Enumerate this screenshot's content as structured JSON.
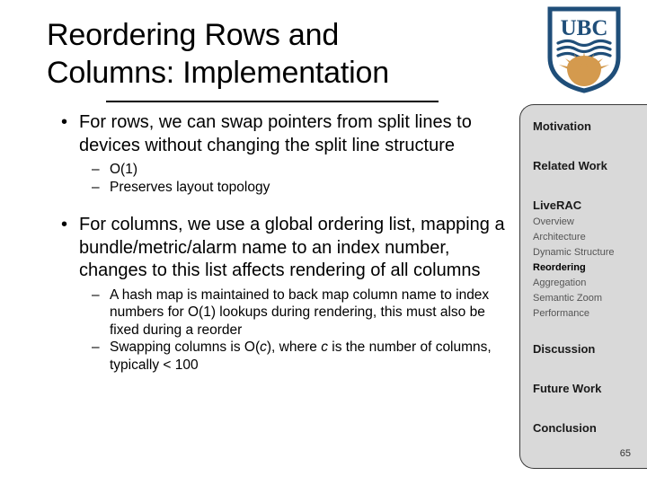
{
  "slide": {
    "title_lines": [
      "Reordering Rows and",
      "Columns: Implementation"
    ],
    "slide_number": "65",
    "logo": {
      "name": "ubc-crest",
      "wordmark": "UBC",
      "shield_color": "#1f4e79",
      "sun_color": "#d49a4e"
    }
  },
  "content": {
    "bullet_char": "•",
    "dash_char": "–",
    "bullets": [
      {
        "text": "For rows, we can swap pointers from split lines to devices without changing the split line structure",
        "sub": [
          {
            "text": "O(1)"
          },
          {
            "text": "Preserves layout topology"
          }
        ]
      },
      {
        "text": "For columns, we use a global ordering list, mapping a bundle/metric/alarm name to an index number, changes to this list affects rendering of all columns",
        "sub": [
          {
            "text": "A hash map is maintained to back map column name to index numbers for O(1) lookups during rendering, this must also be fixed during a reorder"
          },
          {
            "parts": [
              {
                "t": "Swapping columns is O(",
                "i": false
              },
              {
                "t": "c",
                "i": true
              },
              {
                "t": "), where ",
                "i": false
              },
              {
                "t": "c",
                "i": true
              },
              {
                "t": " is the number of columns, typically < 100",
                "i": false
              }
            ]
          }
        ]
      }
    ]
  },
  "nav": {
    "background": "#d9d9d9",
    "items": [
      {
        "label": "Motivation",
        "level": "major",
        "current": false
      },
      {
        "label": "Related Work",
        "level": "major",
        "current": false
      },
      {
        "label": "LiveRAC",
        "level": "major",
        "current": false
      },
      {
        "label": "Overview",
        "level": "sub",
        "current": false
      },
      {
        "label": "Architecture",
        "level": "sub",
        "current": false
      },
      {
        "label": "Dynamic Structure",
        "level": "sub",
        "current": false
      },
      {
        "label": "Reordering",
        "level": "sub",
        "current": true
      },
      {
        "label": "Aggregation",
        "level": "sub",
        "current": false
      },
      {
        "label": "Semantic Zoom",
        "level": "sub",
        "current": false
      },
      {
        "label": "Performance",
        "level": "sub",
        "current": false
      },
      {
        "label": "Discussion",
        "level": "major",
        "current": false
      },
      {
        "label": "Future Work",
        "level": "major",
        "current": false
      },
      {
        "label": "Conclusion",
        "level": "major",
        "current": false
      }
    ]
  }
}
